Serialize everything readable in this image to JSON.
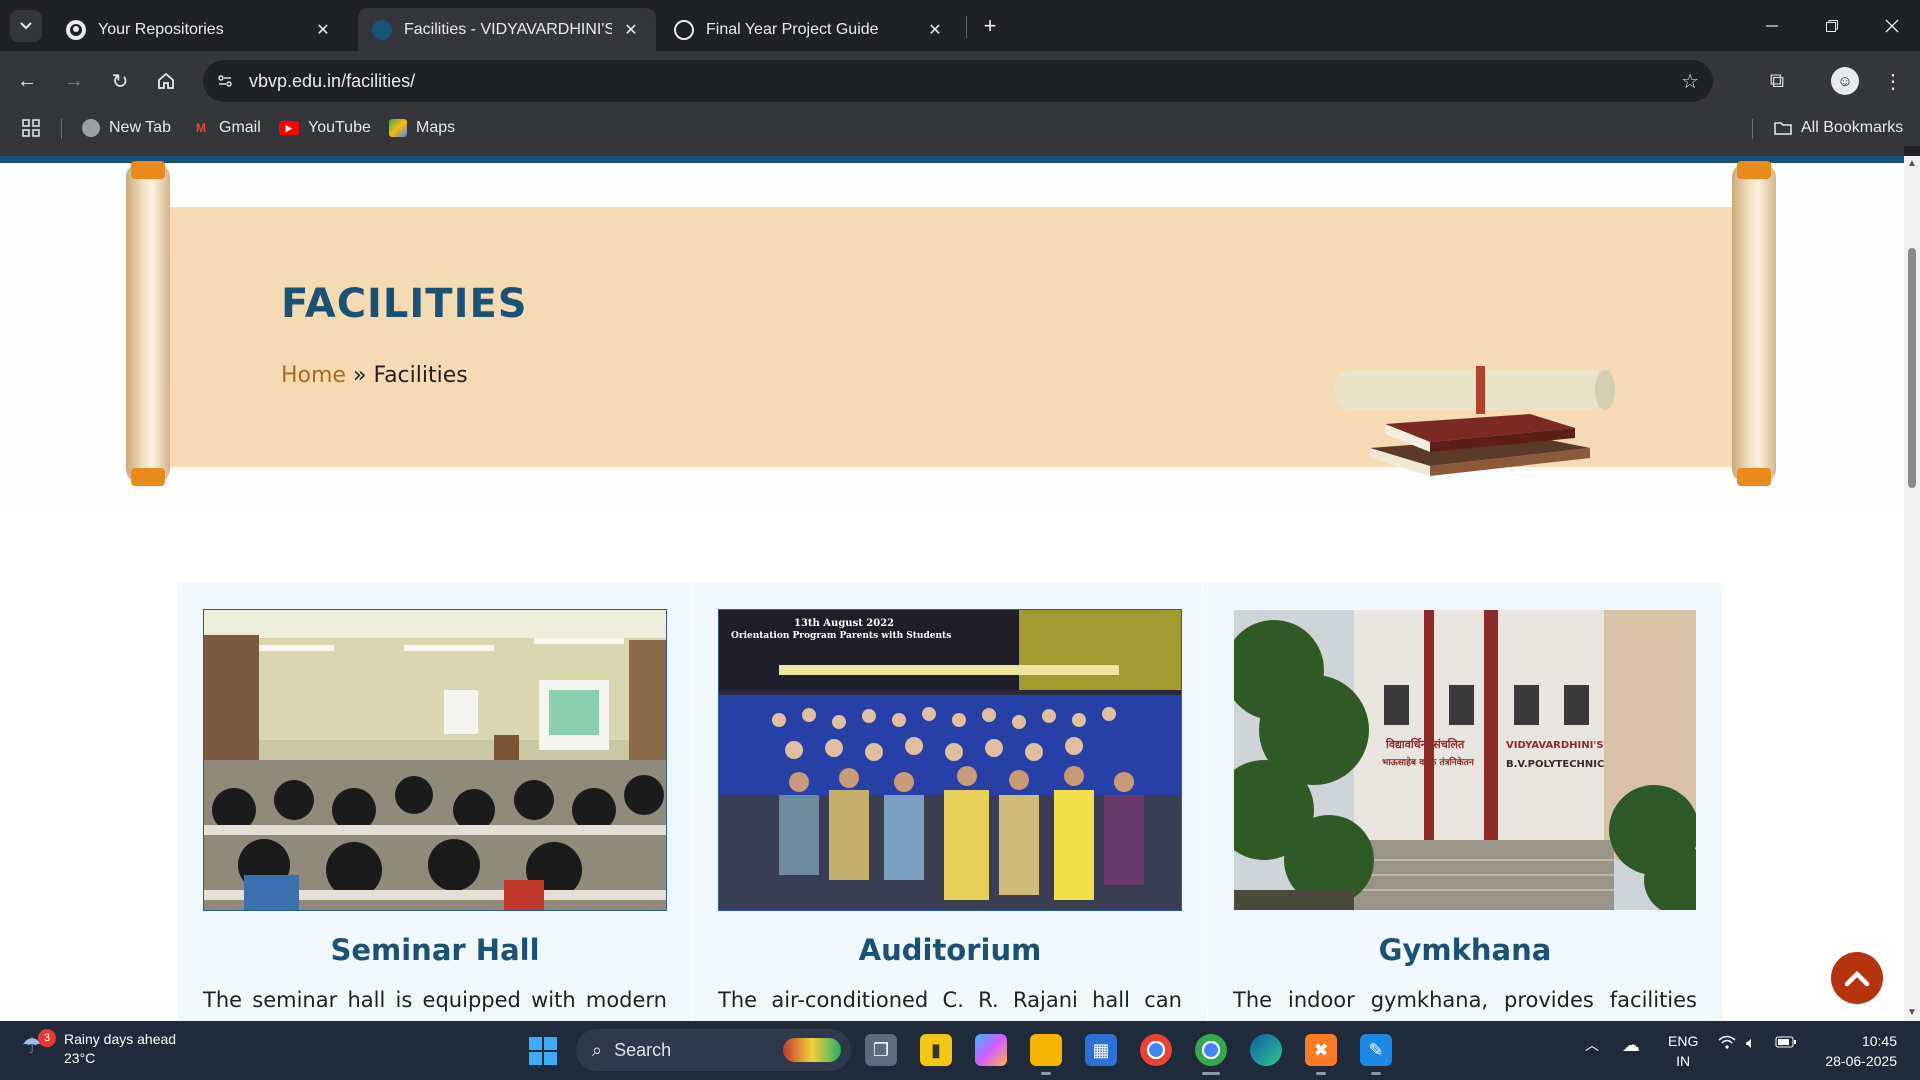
{
  "browser": {
    "tabs": [
      {
        "title": "Your Repositories",
        "icon": "github-icon",
        "active": false
      },
      {
        "title": "Facilities - VIDYAVARDHINI'S BHAUSAHEB VARTAK POLYTECHNIC",
        "icon": "site-favicon",
        "active": true
      },
      {
        "title": "Final Year Project Guide",
        "icon": "chatgpt-icon",
        "active": false
      }
    ],
    "url": "vbvp.edu.in/facilities/",
    "bookmarks": [
      {
        "label": "New Tab",
        "icon": "globe-icon"
      },
      {
        "label": "Gmail",
        "icon": "gmail-icon"
      },
      {
        "label": "YouTube",
        "icon": "youtube-icon"
      },
      {
        "label": "Maps",
        "icon": "maps-icon"
      }
    ],
    "all_bookmarks_label": "All Bookmarks"
  },
  "page": {
    "hero": {
      "title": "FACILITIES",
      "breadcrumb_home": "Home",
      "breadcrumb_sep": "»",
      "breadcrumb_current": "Facilities"
    },
    "cards": [
      {
        "title": "Seminar Hall",
        "text": "The seminar hall is equipped with modern"
      },
      {
        "title": "Auditorium",
        "text": "The air-conditioned C. R. Rajani hall can",
        "photo_caption_1": "13th August 2022",
        "photo_caption_2": "Orientation Program Parents with Students"
      },
      {
        "title": "Gymkhana",
        "text": "The indoor gymkhana, provides facilities",
        "sign_left_1": "विद्यावर्धिनी संचलित",
        "sign_left_2": "भाऊसाहेब वर्तक तंत्रनिकेतन",
        "sign_right_1": "VIDYAVARDHINI'S",
        "sign_right_2": "B.V.POLYTECHNIC"
      }
    ]
  },
  "taskbar": {
    "weather_title": "Rainy days ahead",
    "weather_temp": "23°C",
    "weather_badge": "3",
    "search_placeholder": "Search",
    "lang_1": "ENG",
    "lang_2": "IN",
    "time": "10:45",
    "date": "28-06-2025"
  },
  "colors": {
    "accent_blue": "#1a5276",
    "breadcrumb_home": "#b4661a",
    "scroll_parchment": "#f5dbb4",
    "back_to_top": "#b5340f"
  }
}
